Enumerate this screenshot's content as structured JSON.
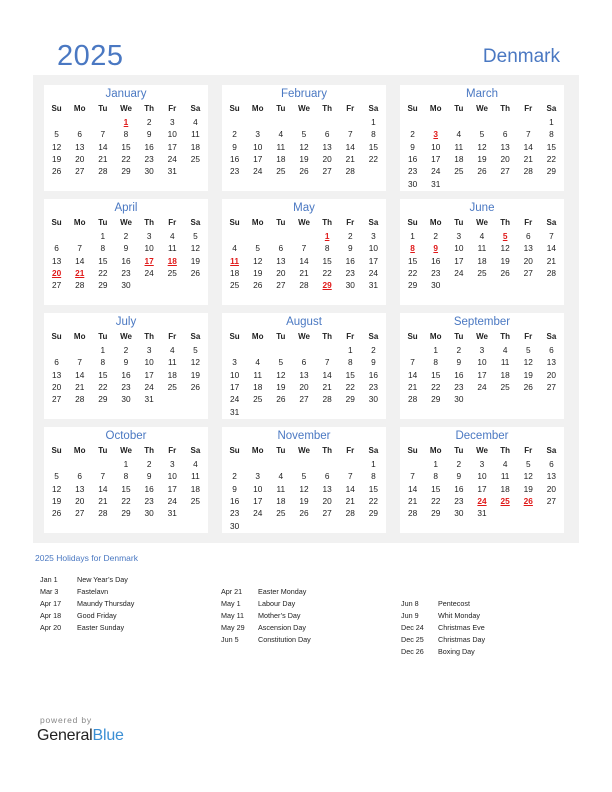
{
  "header": {
    "year": "2025",
    "country": "Denmark"
  },
  "weekday_labels": [
    "Su",
    "Mo",
    "Tu",
    "We",
    "Th",
    "Fr",
    "Sa"
  ],
  "months": [
    {
      "name": "January",
      "first_weekday": 3,
      "days": 31,
      "holidays": [
        1
      ]
    },
    {
      "name": "February",
      "first_weekday": 6,
      "days": 28,
      "holidays": []
    },
    {
      "name": "March",
      "first_weekday": 6,
      "days": 31,
      "holidays": [
        3
      ]
    },
    {
      "name": "April",
      "first_weekday": 2,
      "days": 30,
      "holidays": [
        17,
        18,
        20,
        21
      ]
    },
    {
      "name": "May",
      "first_weekday": 4,
      "days": 31,
      "holidays": [
        1,
        11,
        29
      ]
    },
    {
      "name": "June",
      "first_weekday": 0,
      "days": 30,
      "holidays": [
        5,
        8,
        9
      ]
    },
    {
      "name": "July",
      "first_weekday": 2,
      "days": 31,
      "holidays": []
    },
    {
      "name": "August",
      "first_weekday": 5,
      "days": 31,
      "holidays": []
    },
    {
      "name": "September",
      "first_weekday": 1,
      "days": 30,
      "holidays": []
    },
    {
      "name": "October",
      "first_weekday": 3,
      "days": 31,
      "holidays": []
    },
    {
      "name": "November",
      "first_weekday": 6,
      "days": 30,
      "holidays": []
    },
    {
      "name": "December",
      "first_weekday": 1,
      "days": 31,
      "holidays": [
        24,
        25,
        26
      ]
    }
  ],
  "holidays_section": {
    "title": "2025 Holidays for Denmark",
    "columns": [
      [
        {
          "date": "Jan 1",
          "name": "New Year’s Day"
        },
        {
          "date": "Mar 3",
          "name": "Fastelavn"
        },
        {
          "date": "Apr 17",
          "name": "Maundy Thursday"
        },
        {
          "date": "Apr 18",
          "name": "Good Friday"
        },
        {
          "date": "Apr 20",
          "name": "Easter Sunday"
        }
      ],
      [
        {
          "date": "Apr 21",
          "name": "Easter Monday"
        },
        {
          "date": "May 1",
          "name": "Labour Day"
        },
        {
          "date": "May 11",
          "name": "Mother’s Day"
        },
        {
          "date": "May 29",
          "name": "Ascension Day"
        },
        {
          "date": "Jun 5",
          "name": "Constitution Day"
        }
      ],
      [
        {
          "date": "Jun 8",
          "name": "Pentecost"
        },
        {
          "date": "Jun 9",
          "name": "Whit Monday"
        },
        {
          "date": "Dec 24",
          "name": "Christmas Eve"
        },
        {
          "date": "Dec 25",
          "name": "Christmas Day"
        },
        {
          "date": "Dec 26",
          "name": "Boxing Day"
        }
      ]
    ]
  },
  "footer": {
    "powered_by": "powered by",
    "brand_part1": "General",
    "brand_part2": "Blue"
  },
  "colors": {
    "accent": "#4a78c2",
    "holiday": "#e01818",
    "brand_blue": "#3b8fd4",
    "panel_bg": "#f1f1f1"
  }
}
